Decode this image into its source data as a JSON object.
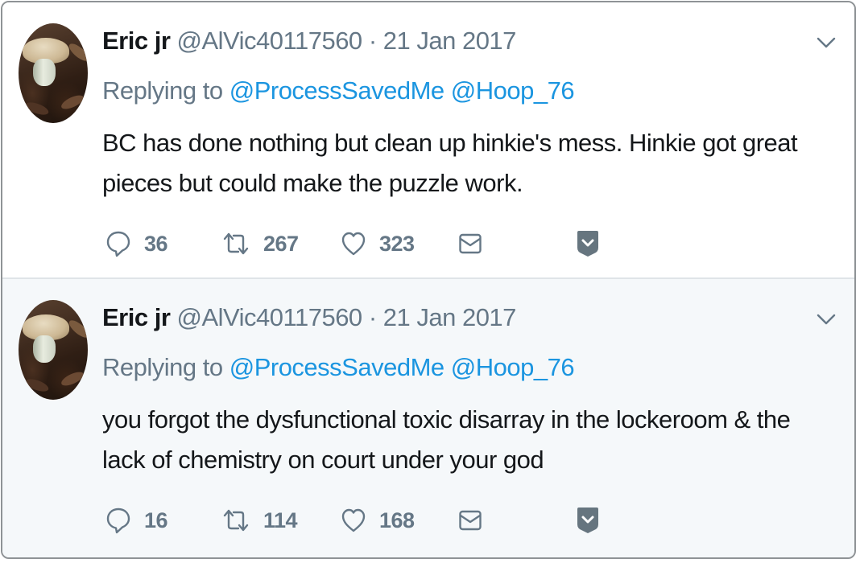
{
  "colors": {
    "name": "#14171a",
    "muted": "#657786",
    "link": "#1b95e0",
    "save_badge": "#66757f"
  },
  "tweets": [
    {
      "display_name": "Eric jr",
      "handle": "@AlVic40117560",
      "separator": "·",
      "date": "21 Jan 2017",
      "replying_prefix": "Replying to",
      "reply_handles": [
        "@ProcessSavedMe",
        "@Hoop_76"
      ],
      "text": "BC has done nothing but clean up hinkie's mess. Hinkie got great pieces but could make the puzzle work.",
      "replies": "36",
      "retweets": "267",
      "likes": "323",
      "icons": [
        "reply-icon",
        "retweet-icon",
        "heart-icon",
        "envelope-icon",
        "save-badge-icon",
        "chevron-down-icon"
      ]
    },
    {
      "display_name": "Eric jr",
      "handle": "@AlVic40117560",
      "separator": "·",
      "date": "21 Jan 2017",
      "replying_prefix": "Replying to",
      "reply_handles": [
        "@ProcessSavedMe",
        "@Hoop_76"
      ],
      "text": "you forgot the dysfunctional toxic disarray in the lockeroom & the lack of chemistry on court under your god",
      "replies": "16",
      "retweets": "114",
      "likes": "168",
      "icons": [
        "reply-icon",
        "retweet-icon",
        "heart-icon",
        "envelope-icon",
        "save-badge-icon",
        "chevron-down-icon"
      ]
    }
  ]
}
